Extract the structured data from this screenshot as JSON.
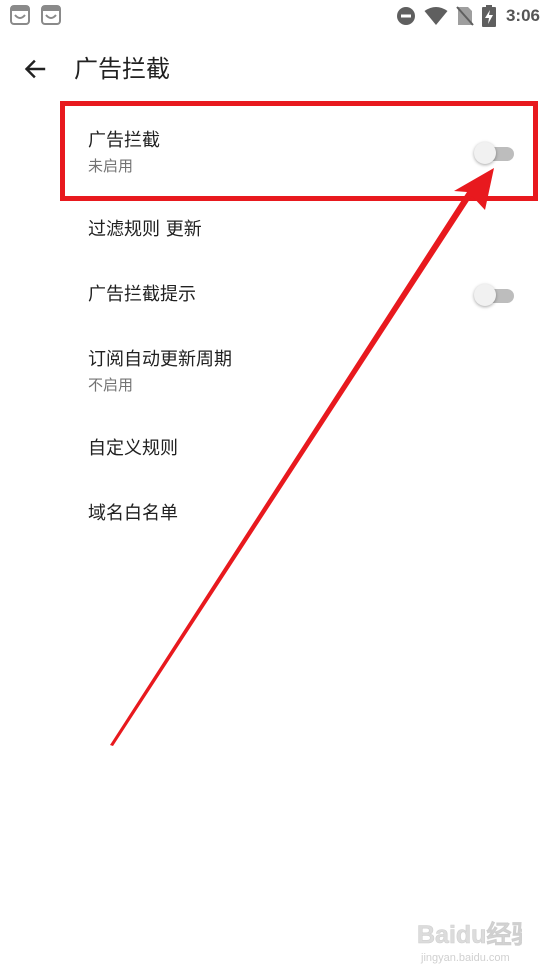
{
  "status_bar": {
    "time": "3:06",
    "icons": [
      "app-notification-icon",
      "app-notification-icon",
      "do-not-disturb-icon",
      "wifi-icon",
      "no-sim-icon",
      "battery-charging-icon"
    ]
  },
  "app_bar": {
    "back_icon": "arrow-left-icon",
    "title": "广告拦截"
  },
  "settings": [
    {
      "title": "广告拦截",
      "summary": "未启用",
      "toggle": false
    },
    {
      "title": "过滤规则 更新"
    },
    {
      "title": "广告拦截提示",
      "toggle": false
    },
    {
      "title": "订阅自动更新周期",
      "summary": "不启用"
    },
    {
      "title": "自定义规则"
    },
    {
      "title": "域名白名单"
    }
  ],
  "annotation": {
    "color": "#e8191e"
  },
  "watermark": {
    "logo": "Baidu经验",
    "subtext": "jingyan.baidu.com"
  }
}
